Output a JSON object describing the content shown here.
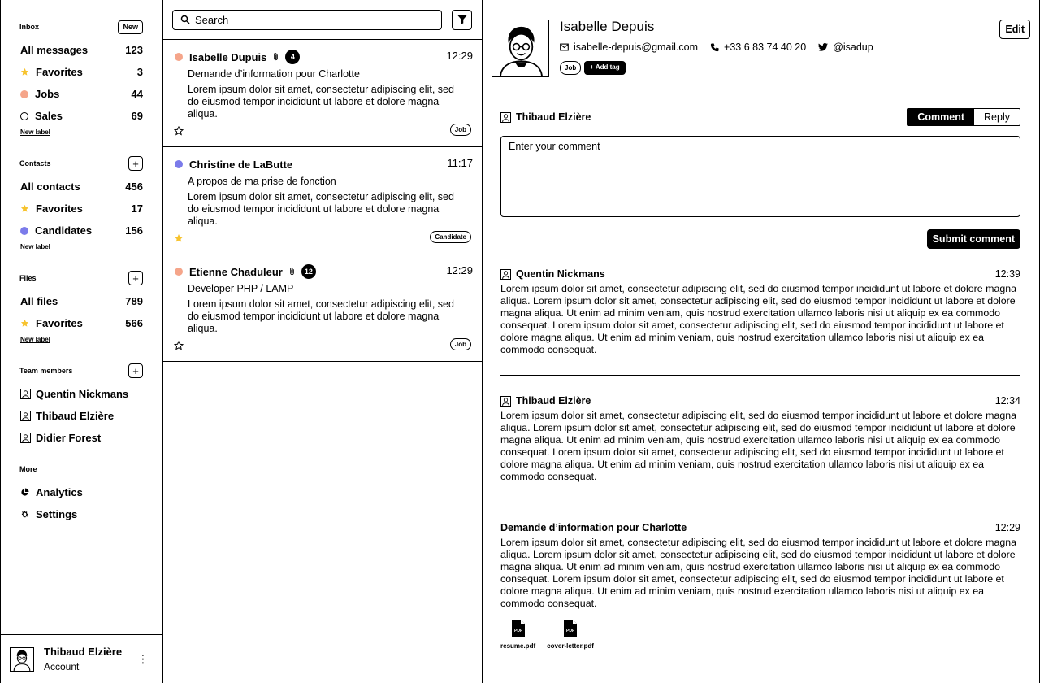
{
  "sidebar": {
    "inbox": {
      "title": "Inbox",
      "new_button": "New",
      "items": [
        {
          "label": "All messages",
          "count": "123"
        },
        {
          "label": "Favorites",
          "count": "3"
        },
        {
          "label": "Jobs",
          "count": "44"
        },
        {
          "label": "Sales",
          "count": "69"
        }
      ],
      "new_label": "New label"
    },
    "contacts": {
      "title": "Contacts",
      "add_button": "+",
      "items": [
        {
          "label": "All contacts",
          "count": "456"
        },
        {
          "label": "Favorites",
          "count": "17"
        },
        {
          "label": "Candidates",
          "count": "156"
        }
      ],
      "new_label": "New label"
    },
    "files": {
      "title": "Files",
      "add_button": "+",
      "items": [
        {
          "label": "All files",
          "count": "789"
        },
        {
          "label": "Favorites",
          "count": "566"
        }
      ],
      "new_label": "New label"
    },
    "team": {
      "title": "Team members",
      "add_button": "+",
      "members": [
        "Quentin Nickmans",
        "Thibaud Elzière",
        "Didier Forest"
      ]
    },
    "more": {
      "title": "More",
      "items": [
        {
          "label": "Analytics",
          "icon": "pie-chart-icon"
        },
        {
          "label": "Settings",
          "icon": "gear-icon"
        }
      ]
    },
    "account": {
      "name": "Thibaud Elzière",
      "subtitle": "Account",
      "menu_icon": "⋮"
    }
  },
  "colors": {
    "jobs": "#F5A58A",
    "candidates": "#7B7BEA",
    "star": "#F7C32E"
  },
  "list": {
    "search_placeholder": "Search",
    "messages": [
      {
        "name": "Isabelle Dupuis",
        "count": "4",
        "time": "12:29",
        "subject": "Demande d’information pour Charlotte",
        "body": "Lorem ipsum dolor sit amet, consectetur adipiscing elit, sed do eiusmod tempor incididunt ut labore et dolore magna aliqua.",
        "tag": "Job",
        "starred": false
      },
      {
        "name": "Christine de LaButte",
        "count": "",
        "time": "11:17",
        "subject": "A propos de ma prise de fonction",
        "body": "Lorem ipsum dolor sit amet, consectetur adipiscing elit, sed do eiusmod tempor incididunt ut labore et dolore magna aliqua.",
        "tag": "Candidate",
        "starred": true
      },
      {
        "name": "Etienne Chaduleur",
        "count": "12",
        "time": "12:29",
        "subject": "Developer PHP / LAMP",
        "body": "Lorem ipsum dolor sit amet, consectetur adipiscing elit, sed do eiusmod tempor incididunt ut labore et dolore magna aliqua.",
        "tag": "Job",
        "starred": false
      }
    ]
  },
  "detail": {
    "contact": {
      "name": "Isabelle Depuis",
      "email": "isabelle-depuis@gmail.com",
      "phone": "+33 6 83 74 40 20",
      "twitter": "@isadup",
      "tag": "Job",
      "add_tag": "+ Add tag",
      "edit": "Edit"
    },
    "composer": {
      "user": "Thibaud Elzière",
      "tab_comment": "Comment",
      "tab_reply": "Reply",
      "placeholder": "Enter your comment",
      "submit": "Submit comment"
    },
    "entries": [
      {
        "author": "Quentin Nickmans",
        "time": "12:39",
        "body": "Lorem ipsum dolor sit amet, consectetur adipiscing elit, sed do eiusmod tempor incididunt ut labore et dolore magna aliqua. Lorem ipsum dolor sit amet, consectetur adipiscing elit, sed do eiusmod tempor incididunt ut labore et dolore magna aliqua. Ut enim ad minim veniam, quis nostrud exercitation ullamco laboris nisi ut aliquip ex ea commodo consequat. Lorem ipsum dolor sit amet, consectetur adipiscing elit, sed do eiusmod tempor incididunt ut labore et dolore magna aliqua. Ut enim ad minim veniam, quis nostrud exercitation ullamco laboris nisi ut aliquip ex ea commodo consequat."
      },
      {
        "author": "Thibaud Elzière",
        "time": "12:34",
        "body": "Lorem ipsum dolor sit amet, consectetur adipiscing elit, sed do eiusmod tempor incididunt ut labore et dolore magna aliqua. Lorem ipsum dolor sit amet, consectetur adipiscing elit, sed do eiusmod tempor incididunt ut labore et dolore magna aliqua. Ut enim ad minim veniam, quis nostrud exercitation ullamco laboris nisi ut aliquip ex ea commodo consequat. Lorem ipsum dolor sit amet, consectetur adipiscing elit, sed do eiusmod tempor incididunt ut labore et dolore magna aliqua. Ut enim ad minim veniam, quis nostrud exercitation ullamco laboris nisi ut aliquip ex ea commodo consequat."
      },
      {
        "author": "Demande d’information pour Charlotte",
        "time": "12:29",
        "body": "Lorem ipsum dolor sit amet, consectetur adipiscing elit, sed do eiusmod tempor incididunt ut labore et dolore magna aliqua. Lorem ipsum dolor sit amet, consectetur adipiscing elit, sed do eiusmod tempor incididunt ut labore et dolore magna aliqua. Ut enim ad minim veniam, quis nostrud exercitation ullamco laboris nisi ut aliquip ex ea commodo consequat. Lorem ipsum dolor sit amet, consectetur adipiscing elit, sed do eiusmod tempor incididunt ut labore et dolore magna aliqua. Ut enim ad minim veniam, quis nostrud exercitation ullamco laboris nisi ut aliquip ex ea commodo consequat.",
        "attachments": [
          "resume.pdf",
          "cover-letter.pdf"
        ]
      }
    ]
  }
}
